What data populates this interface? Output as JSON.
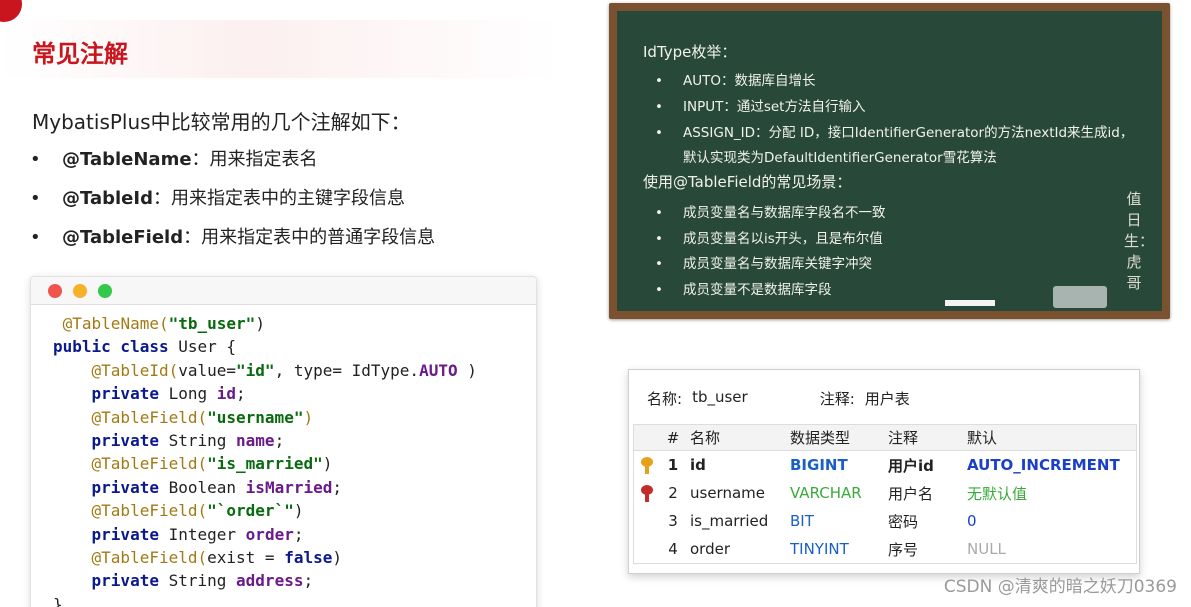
{
  "slide": {
    "title": "常见注解",
    "intro": "MybatisPlus中比较常用的几个注解如下：",
    "bullets": [
      {
        "dot": "•",
        "name": "@TableName",
        "desc": "：用来指定表名"
      },
      {
        "dot": "•",
        "name": "@TableId",
        "desc": "：用来指定表中的主键字段信息"
      },
      {
        "dot": "•",
        "name": "@TableField",
        "desc": "：用来指定表中的普通字段信息"
      }
    ]
  },
  "code": {
    "l1_ann": "@TableName(",
    "l1_str": "\"tb_user\"",
    "l1_end": ")",
    "l2_kw": "public class",
    "l2_rest": " User {",
    "l3_ann": "@TableId(",
    "l3_a": "value=",
    "l3_str": "\"id\"",
    "l3_b": ", type= IdType.",
    "l3_c": "AUTO",
    "l3_d": " )",
    "l4_kw": "private",
    "l4_type": " Long ",
    "l4_f": "id",
    "l4_end": ";",
    "l5_ann": "@TableField(",
    "l5_str": "\"username\"",
    "l5_end": ")",
    "l6_kw": "private",
    "l6_type": " String ",
    "l6_f": "name",
    "l6_end": ";",
    "l7_ann": "@TableField(",
    "l7_str": "\"is_married\"",
    "l7_end": ")",
    "l8_kw": "private",
    "l8_type": " Boolean ",
    "l8_f": "isMarried",
    "l8_end": ";",
    "l9_ann": "@TableField(",
    "l9_str": "\"`order`\"",
    "l9_end": ")",
    "l10_kw": "private",
    "l10_type": " Integer ",
    "l10_f": "order",
    "l10_end": ";",
    "l11_ann": "@TableField(",
    "l11_a": "exist = ",
    "l11_kw": "false",
    "l11_end": ")",
    "l12_kw": "private",
    "l12_type": " String ",
    "l12_f": "address",
    "l12_end": ";",
    "l13": "}"
  },
  "board": {
    "heading1": "IdType枚举：",
    "items1": [
      "AUTO：数据库自增长",
      "INPUT：通过set方法自行输入",
      "ASSIGN_ID：分配 ID，接口IdentifierGenerator的方法nextId来生成id，"
    ],
    "items1_cont": "默认实现类为DefaultIdentifierGenerator雪花算法",
    "heading2": "使用@TableField的常见场景：",
    "items2": [
      "成员变量名与数据库字段名不一致",
      "成员变量名以is开头，且是布尔值",
      "成员变量名与数据库关键字冲突",
      "成员变量不是数据库字段"
    ],
    "bullet": "•",
    "sign": "值日生：虎哥"
  },
  "table": {
    "name_label": "名称:",
    "name_value": "tb_user",
    "comment_label": "注释:",
    "comment_value": "用户表",
    "headers": [
      "#",
      "名称",
      "数据类型",
      "注释",
      "默认"
    ],
    "rows": [
      {
        "num": "1",
        "name": "id",
        "type": "BIGINT",
        "note": "用户id",
        "default": "AUTO_INCREMENT"
      },
      {
        "num": "2",
        "name": "username",
        "type": "VARCHAR",
        "note": "用户名",
        "default": "无默认值"
      },
      {
        "num": "3",
        "name": "is_married",
        "type": "BIT",
        "note": "密码",
        "default": "0"
      },
      {
        "num": "4",
        "name": "order",
        "type": "TINYINT",
        "note": "序号",
        "default": "NULL"
      }
    ],
    "colors": {
      "type": "#1a5fc8",
      "default_auto": "#1a3fc8",
      "default_none": "#3aaa3a",
      "default_zero": "#1a3fc8",
      "default_null": "#aaaaaa"
    }
  },
  "watermark": "CSDN @清爽的暗之妖刀0369"
}
